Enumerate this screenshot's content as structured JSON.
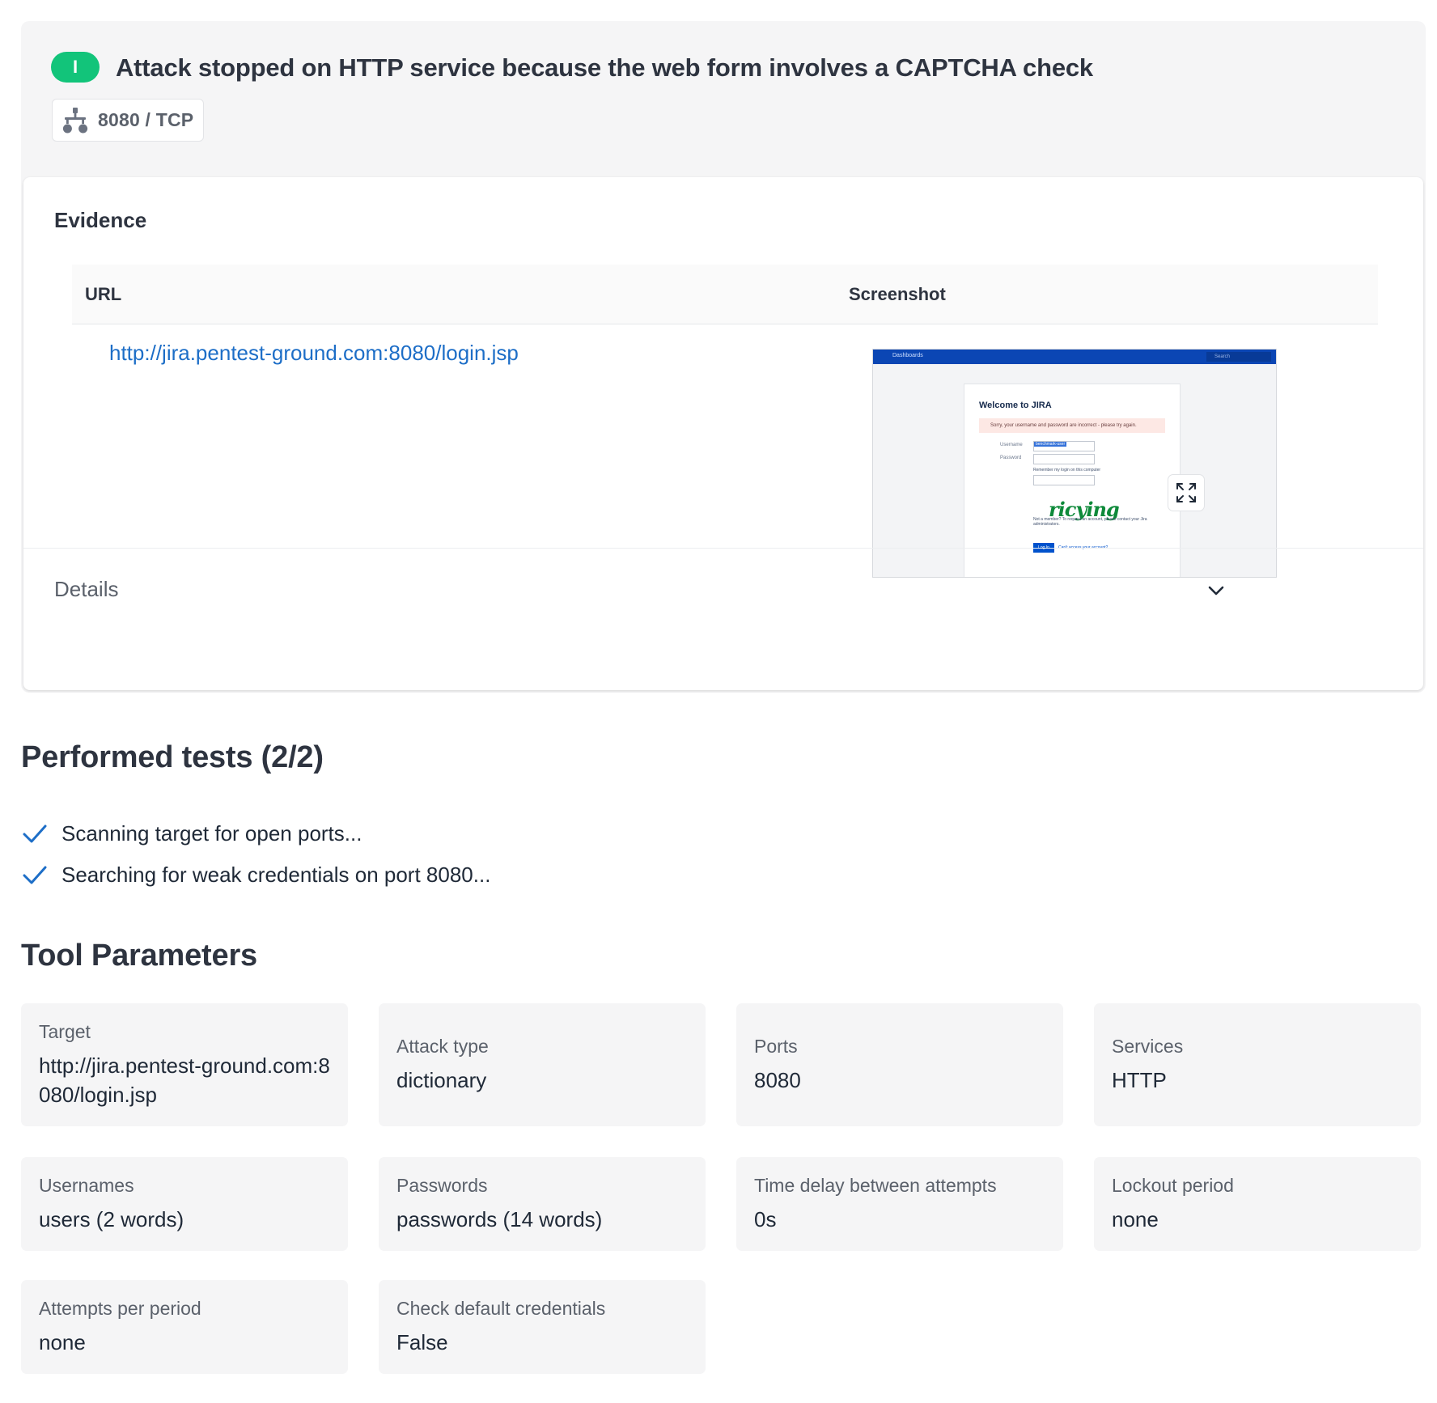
{
  "finding": {
    "severity_badge": "I",
    "title": "Attack stopped on HTTP service because the web form involves a CAPTCHA check",
    "port_chip": "8080 / TCP",
    "evidence": {
      "title": "Evidence",
      "col_url": "URL",
      "col_screenshot": "Screenshot",
      "url": "http://jira.pentest-ground.com:8080/login.jsp",
      "screenshot": {
        "nav_label": "Dashboards",
        "search_label": "Search",
        "welcome": "Welcome to JIRA",
        "error": "Sorry, your username and password are incorrect - please try again.",
        "username_label": "Username",
        "password_label": "Password",
        "username_value": "benchmark-user",
        "remember": "Remember my login on this computer",
        "captcha_word": "ricying",
        "not_member": "Not a member? To request an account, please contact your Jira administrators.",
        "login_button": "Log In",
        "cant_access": "Can't access your account?"
      }
    },
    "details_label": "Details"
  },
  "performed_tests": {
    "title": "Performed tests (2/2)",
    "items": [
      "Scanning target for open ports...",
      "Searching for weak credentials on port 8080..."
    ]
  },
  "tool_parameters": {
    "title": "Tool Parameters",
    "items": [
      {
        "label": "Target",
        "value": "http://jira.pentest-ground.com:8080/login.jsp"
      },
      {
        "label": "Attack type",
        "value": "dictionary"
      },
      {
        "label": "Ports",
        "value": "8080"
      },
      {
        "label": "Services",
        "value": "HTTP"
      },
      {
        "label": "Usernames",
        "value": "users (2 words)"
      },
      {
        "label": "Passwords",
        "value": "passwords (14 words)"
      },
      {
        "label": "Time delay between attempts",
        "value": "0s"
      },
      {
        "label": "Lockout period",
        "value": "none"
      },
      {
        "label": "Attempts per period",
        "value": "none"
      },
      {
        "label": "Check default credentials",
        "value": "False"
      }
    ]
  },
  "colors": {
    "badge_green": "#12c47a",
    "link_blue": "#1d6ec7",
    "check_blue": "#1d6ec7",
    "card_bg": "#f5f5f6"
  }
}
